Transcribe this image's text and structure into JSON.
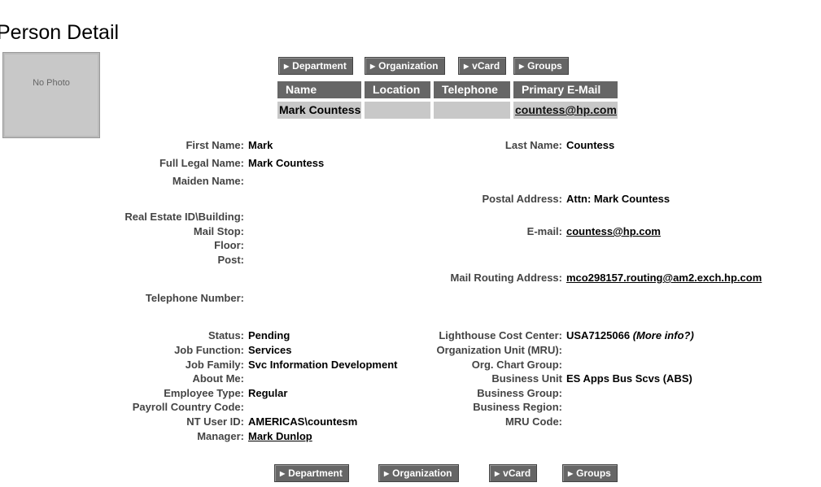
{
  "page_title": "Person Detail",
  "photo_placeholder": "No Photo",
  "nav_buttons": [
    "Department",
    "Organization",
    "vCard",
    "Groups"
  ],
  "summary_table": {
    "headers": [
      "Name",
      "Location",
      "Telephone",
      "Primary E-Mail"
    ],
    "row": [
      "Mark Countess",
      "",
      "",
      "countess@hp.com"
    ]
  },
  "left_fields": [
    {
      "label": "First Name:",
      "value": "Mark"
    },
    {
      "label": "Full Legal Name:",
      "value": "Mark Countess"
    },
    {
      "label": "Maiden Name:",
      "value": ""
    },
    {
      "label": "Real Estate ID\\Building:",
      "value": ""
    },
    {
      "label": "Mail Stop:",
      "value": ""
    },
    {
      "label": "Floor:",
      "value": ""
    },
    {
      "label": "Post:",
      "value": ""
    },
    {
      "label": "Telephone Number:",
      "value": ""
    },
    {
      "label": "Status:",
      "value": "Pending"
    },
    {
      "label": "Job Function:",
      "value": "Services"
    },
    {
      "label": "Job Family:",
      "value": "Svc Information Development"
    },
    {
      "label": "About Me:",
      "value": ""
    },
    {
      "label": "Employee Type:",
      "value": "Regular"
    },
    {
      "label": "Payroll Country Code:",
      "value": ""
    },
    {
      "label": "NT User ID:",
      "value": "AMERICAS\\countesm"
    },
    {
      "label": "Manager:",
      "value": "Mark Dunlop"
    }
  ],
  "right_fields": [
    {
      "label": "Last Name:",
      "value": "Countess"
    },
    {
      "label": "Postal Address:",
      "value": "Attn: Mark Countess"
    },
    {
      "label": "E-mail:",
      "value": "countess@hp.com"
    },
    {
      "label": "Mail Routing Address:",
      "value": "mco298157.routing@am2.exch.hp.com"
    },
    {
      "label": "Lighthouse Cost Center:",
      "value": "USA7125066",
      "extra": "(More info?)"
    },
    {
      "label": "Organization Unit (MRU):",
      "value": ""
    },
    {
      "label": "Org. Chart Group:",
      "value": ""
    },
    {
      "label": "Business Unit",
      "value": "ES Apps Bus Scvs (ABS)"
    },
    {
      "label": "Business Group:",
      "value": ""
    },
    {
      "label": "Business Region:",
      "value": ""
    },
    {
      "label": "MRU Code:",
      "value": ""
    }
  ]
}
